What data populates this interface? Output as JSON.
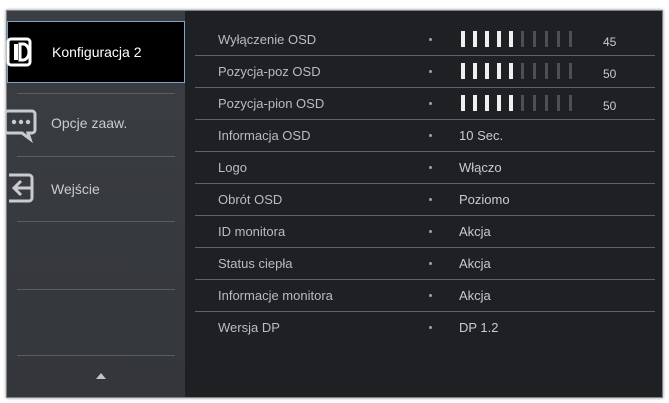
{
  "sidebar": {
    "items": [
      {
        "label": "Konfiguracja 2",
        "icon": "display-icon",
        "active": true
      },
      {
        "label": "Opcje zaaw.",
        "icon": "speech-bubble-icon",
        "active": false
      },
      {
        "label": "Wejście",
        "icon": "input-arrow-icon",
        "active": false
      }
    ],
    "scroll_icon": "up-arrow-icon"
  },
  "settings": [
    {
      "label": "Wyłączenie OSD",
      "type": "slider",
      "value": "45",
      "level": 0.45
    },
    {
      "label": "Pozycja-poz OSD",
      "type": "slider",
      "value": "50",
      "level": 0.5
    },
    {
      "label": "Pozycja-pion OSD",
      "type": "slider",
      "value": "50",
      "level": 0.5
    },
    {
      "label": "Informacja OSD",
      "type": "text",
      "value": "10 Sec."
    },
    {
      "label": "Logo",
      "type": "text",
      "value": "Włączo"
    },
    {
      "label": "Obrót OSD",
      "type": "text",
      "value": "Poziomo"
    },
    {
      "label": "ID monitora",
      "type": "text",
      "value": "Akcja"
    },
    {
      "label": "Status ciepła",
      "type": "text",
      "value": "Akcja"
    },
    {
      "label": "Informacje monitora",
      "type": "text",
      "value": "Akcja"
    },
    {
      "label": "Wersja DP",
      "type": "text",
      "value": "DP 1.2"
    }
  ],
  "colors": {
    "background": "#1e2024",
    "sidebar": "#383b40",
    "active_border": "#7ea3c9",
    "text": "#c8cbd0"
  }
}
